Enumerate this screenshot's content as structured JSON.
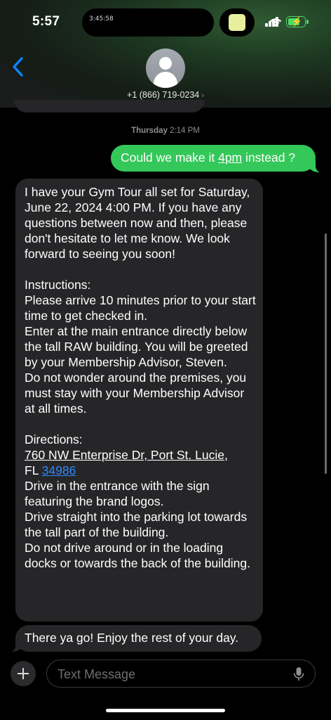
{
  "status_bar": {
    "time": "5:57",
    "island_timer": "3:45:58",
    "battery_color": "#4cd964"
  },
  "contact": {
    "phone": "+1 (866) 719-0234",
    "chevron": "›"
  },
  "thread": {
    "timestamp_day": "Thursday",
    "timestamp_time": "2:14 PM",
    "sent": {
      "before": "Could we make it ",
      "underlined": "4pm",
      "after": " instead ?"
    },
    "received_1": {
      "intro": "I have your Gym Tour all set for Saturday, June 22, 2024 4:00 PM. If you have any questions between now and then, please don't hesitate to let me know. We look forward to seeing you soon!",
      "instructions_title": "Instructions:",
      "instr_1": "Please arrive 10 minutes prior to your start time to get checked in.",
      "instr_2": "Enter at the main entrance directly below the tall RAW building. You will be greeted by your Membership Advisor, Steven.",
      "instr_3": "Do not wonder around the premises, you must stay with your Membership Advisor at all times.",
      "directions_title": "Directions:",
      "address_link": "760 NW Enterprise Dr, Port St. Lucie,",
      "address_state": "FL ",
      "zip_link": "34986",
      "dir_1": "Drive in the entrance with the sign featuring the brand logos.",
      "dir_2": "Drive straight into the parking lot towards the tall part of the building.",
      "dir_3": "Do not drive around or in the loading docks or towards the back of the building."
    },
    "received_2": "There ya go! Enjoy the rest of your day."
  },
  "composer": {
    "placeholder": "Text Message",
    "value": ""
  },
  "colors": {
    "sent_bubble": "#34c759",
    "received_bubble": "#262628",
    "link_blue": "#2f86ff",
    "back_blue": "#0a84ff"
  },
  "icons": [
    "chevron-left-icon",
    "person-icon",
    "plus-icon",
    "microphone-icon",
    "cellular-signal-icon",
    "wifi-icon",
    "battery-charging-icon"
  ]
}
